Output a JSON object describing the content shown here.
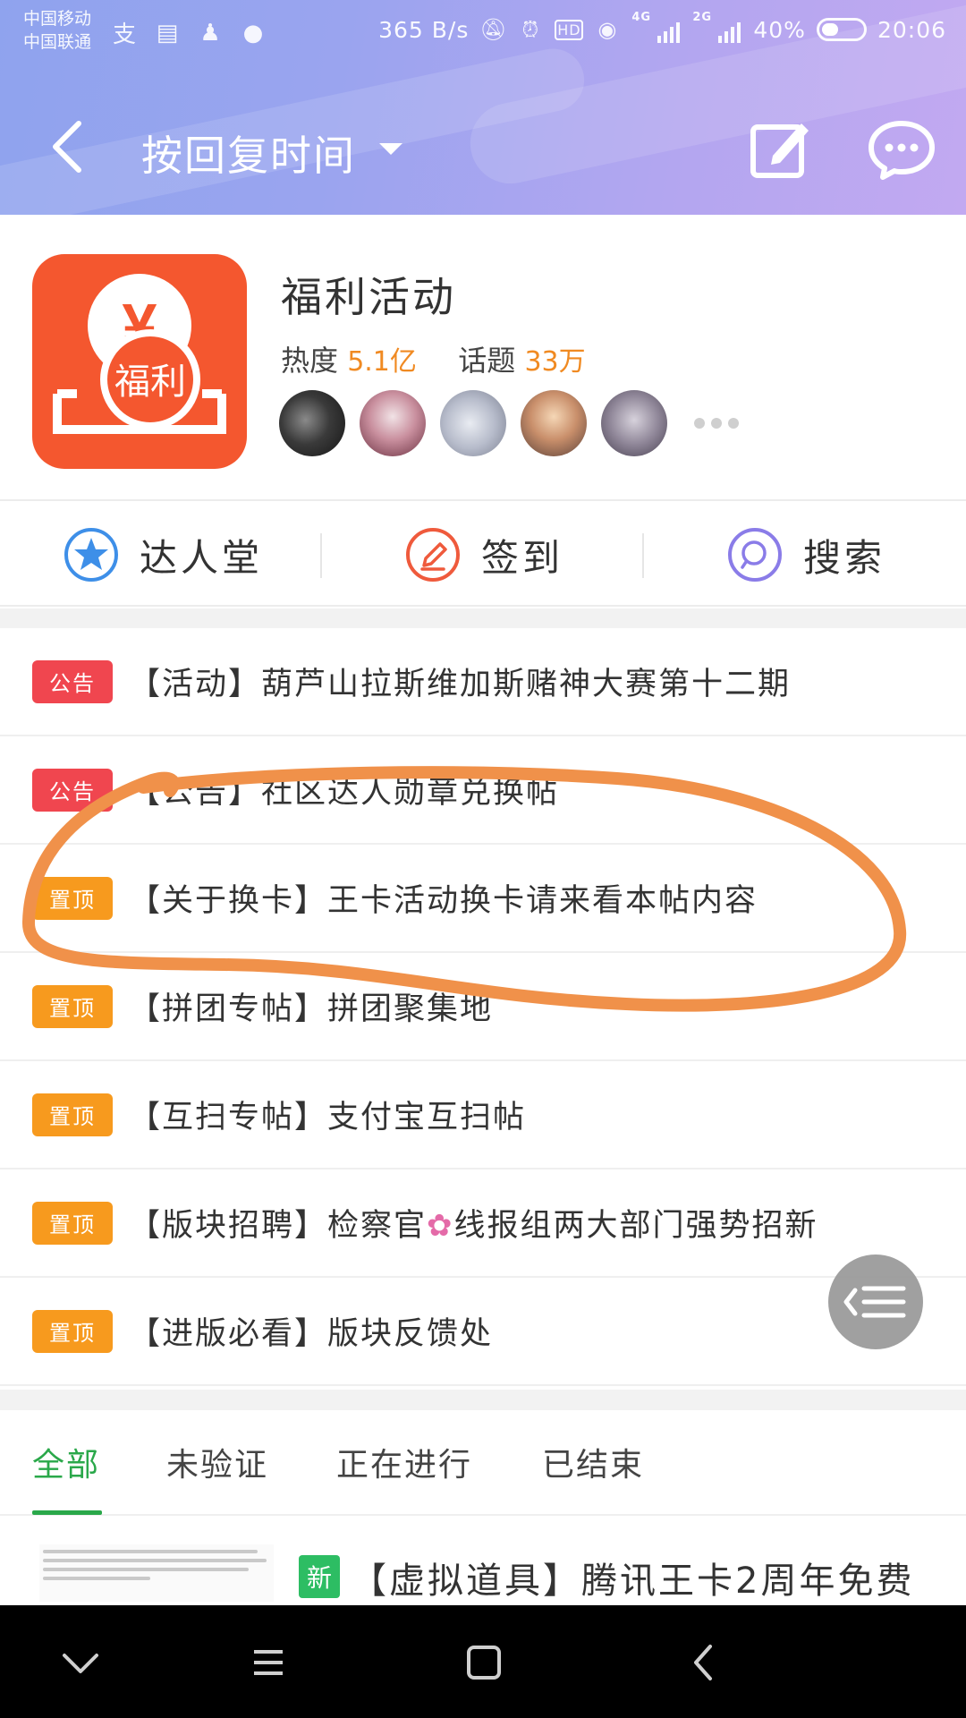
{
  "status_bar": {
    "carrier_1": "中国移动",
    "carrier_2": "中国联通",
    "speed": "365 B/s",
    "net_1": "4G",
    "net_2": "2G",
    "battery": "40%",
    "time": "20:06"
  },
  "navbar": {
    "sort_label": "按回复时间"
  },
  "forum": {
    "name": "福利活动",
    "logo_text": "福利",
    "logo_symbol": "¥",
    "heat_label": "热度",
    "heat_value": "5.1亿",
    "topic_label": "话题",
    "topic_value": "33万"
  },
  "actions": {
    "hall": "达人堂",
    "checkin": "签到",
    "search": "搜索"
  },
  "pinned": [
    {
      "tag": "公告",
      "title": "【活动】葫芦山拉斯维加斯赌神大赛第十二期"
    },
    {
      "tag": "公告",
      "title": "【公告】社区达人勋章兑换帖"
    },
    {
      "tag": "置顶",
      "title": "【关于换卡】王卡活动换卡请来看本帖内容"
    },
    {
      "tag": "置顶",
      "title": "【拼团专帖】拼团聚集地"
    },
    {
      "tag": "置顶",
      "title": "【互扫专帖】支付宝互扫帖"
    },
    {
      "tag": "置顶",
      "title_a": "【版块招聘】检察官",
      "title_b": "线报组两大部门强势招新"
    },
    {
      "tag": "置顶",
      "title": "【进版必看】版块反馈处"
    }
  ],
  "tabs": [
    "全部",
    "未验证",
    "正在进行",
    "已结束"
  ],
  "thread": {
    "new_tag": "新",
    "title": "【虚拟道具】腾讯王卡2周年免费"
  },
  "colors": {
    "header_gradient_start": "#8fa3ee",
    "header_gradient_end": "#c2a9f1",
    "logo_bg": "#f4572f",
    "highlight_orange": "#f08a22",
    "notice_tag": "#f0464f",
    "top_tag": "#f79a1e",
    "tab_active": "#2aa84a",
    "annotation_orange": "#f0914a"
  }
}
